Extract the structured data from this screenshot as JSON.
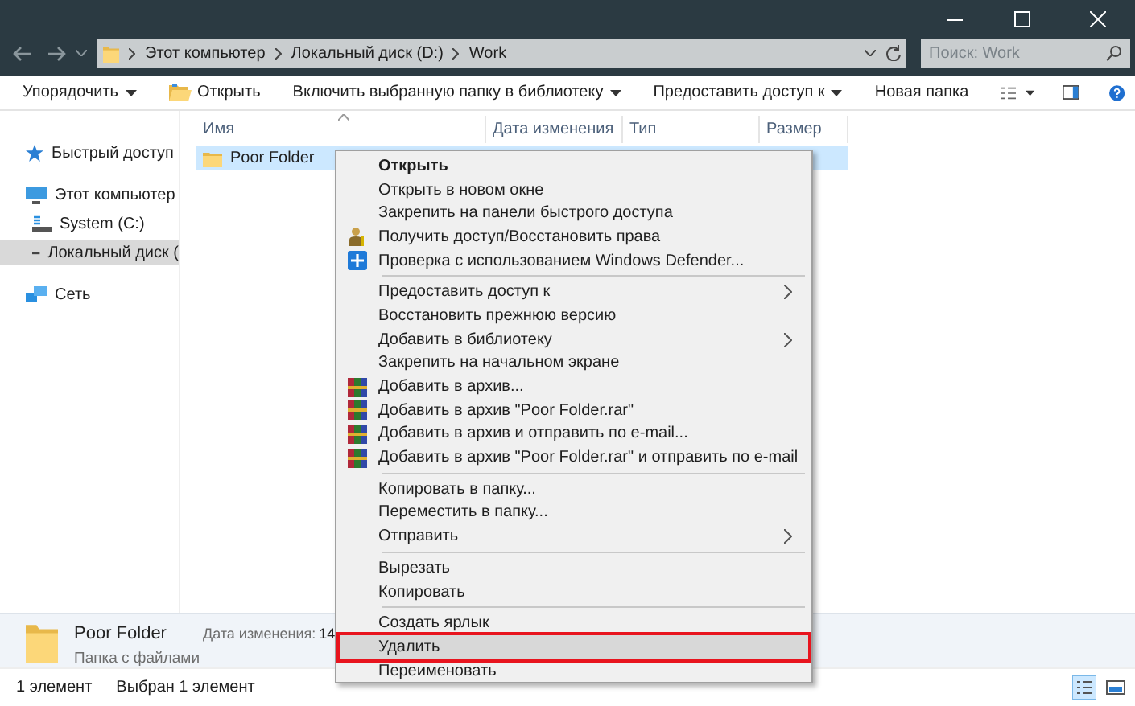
{
  "address_bar": {
    "crumbs": [
      "Этот компьютер",
      "Локальный диск (D:)",
      "Work"
    ]
  },
  "search": {
    "placeholder": "Поиск: Work"
  },
  "toolbar": {
    "buttons": [
      {
        "label": "Упорядочить",
        "dropdown": true,
        "kind": "plain"
      },
      {
        "label": "Открыть",
        "dropdown": false,
        "kind": "open"
      },
      {
        "label": "Включить выбранную папку в библиотеку",
        "dropdown": true,
        "kind": "plain"
      },
      {
        "label": "Предоставить доступ к",
        "dropdown": true,
        "kind": "plain"
      },
      {
        "label": "Новая папка",
        "dropdown": false,
        "kind": "plain"
      }
    ]
  },
  "sidebar": {
    "items": [
      {
        "label": "Быстрый доступ",
        "selected": false,
        "kind": "star"
      },
      {
        "label": "Этот компьютер",
        "selected": false,
        "kind": "computer",
        "children": [
          {
            "label": "System (C:)",
            "selected": false,
            "kind": "system-drive"
          },
          {
            "label": "Локальный диск (",
            "selected": true,
            "kind": "drive"
          }
        ]
      },
      {
        "label": "Сеть",
        "selected": false,
        "kind": "network"
      }
    ]
  },
  "table": {
    "columns": [
      "Имя",
      "Дата изменения",
      "Тип",
      "Размер"
    ],
    "rows": [
      {
        "name": "Poor Folder",
        "selected": true
      }
    ]
  },
  "details": {
    "name": "Poor Folder",
    "type": "Папка с файлами",
    "date_label": "Дата изменения:",
    "date_value": "14"
  },
  "status_bar": {
    "count": "1 элемент",
    "selection": "Выбран 1 элемент"
  },
  "context_menu": {
    "groups": [
      {
        "items": [
          {
            "label": "Открыть",
            "kind": "plain",
            "bold": true,
            "submenu": false,
            "highlighted": false
          },
          {
            "label": "Открыть в новом окне",
            "kind": "plain",
            "bold": false,
            "submenu": false,
            "highlighted": false
          },
          {
            "label": "Закрепить на панели быстрого доступа",
            "kind": "plain",
            "bold": false,
            "submenu": false,
            "highlighted": false
          },
          {
            "label": "Получить доступ/Восстановить права",
            "kind": "rights",
            "bold": false,
            "submenu": false,
            "highlighted": false
          },
          {
            "label": "Проверка с использованием Windows Defender...",
            "kind": "defender",
            "bold": false,
            "submenu": false,
            "highlighted": false
          }
        ]
      },
      {
        "items": [
          {
            "label": "Предоставить доступ к",
            "kind": "plain",
            "bold": false,
            "submenu": true,
            "highlighted": false
          },
          {
            "label": "Восстановить прежнюю версию",
            "kind": "plain",
            "bold": false,
            "submenu": false,
            "highlighted": false
          },
          {
            "label": "Добавить в библиотеку",
            "kind": "plain",
            "bold": false,
            "submenu": true,
            "highlighted": false
          },
          {
            "label": "Закрепить на начальном экране",
            "kind": "plain",
            "bold": false,
            "submenu": false,
            "highlighted": false
          },
          {
            "label": "Добавить в архив...",
            "kind": "archive",
            "bold": false,
            "submenu": false,
            "highlighted": false
          },
          {
            "label": "Добавить в архив \"Poor Folder.rar\"",
            "kind": "archive",
            "bold": false,
            "submenu": false,
            "highlighted": false
          },
          {
            "label": "Добавить в архив и отправить по e-mail...",
            "kind": "archive",
            "bold": false,
            "submenu": false,
            "highlighted": false
          },
          {
            "label": "Добавить в архив \"Poor Folder.rar\" и отправить по e-mail",
            "kind": "archive",
            "bold": false,
            "submenu": false,
            "highlighted": false
          }
        ]
      },
      {
        "items": [
          {
            "label": "Копировать в папку...",
            "kind": "plain",
            "bold": false,
            "submenu": false,
            "highlighted": false
          },
          {
            "label": "Переместить в папку...",
            "kind": "plain",
            "bold": false,
            "submenu": false,
            "highlighted": false
          },
          {
            "label": "Отправить",
            "kind": "plain",
            "bold": false,
            "submenu": true,
            "highlighted": false
          }
        ]
      },
      {
        "items": [
          {
            "label": "Вырезать",
            "kind": "plain",
            "bold": false,
            "submenu": false,
            "highlighted": false
          },
          {
            "label": "Копировать",
            "kind": "plain",
            "bold": false,
            "submenu": false,
            "highlighted": false
          }
        ]
      },
      {
        "items": [
          {
            "label": "Создать ярлык",
            "kind": "plain",
            "bold": false,
            "submenu": false,
            "highlighted": false
          },
          {
            "label": "Удалить",
            "kind": "plain",
            "bold": false,
            "submenu": false,
            "highlighted": true
          },
          {
            "label": "Переименовать",
            "kind": "plain",
            "bold": false,
            "submenu": false,
            "highlighted": false
          }
        ]
      }
    ]
  }
}
